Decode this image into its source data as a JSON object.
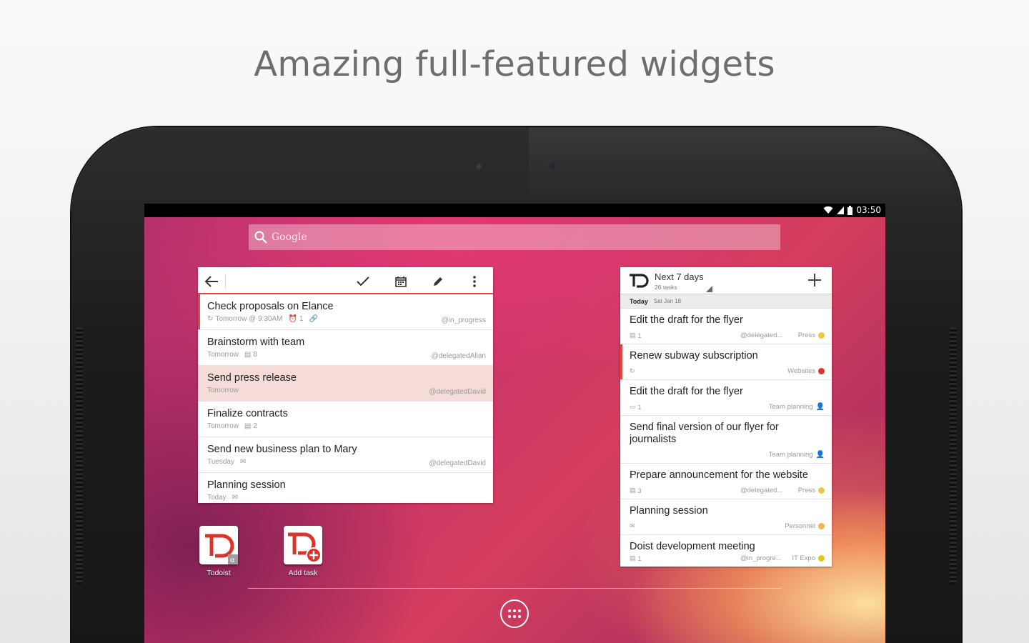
{
  "headline": "Amazing full-featured widgets",
  "status_bar": {
    "time": "03:50",
    "icons": [
      "wifi-icon",
      "signal-icon",
      "battery-icon"
    ]
  },
  "search": {
    "placeholder": "Google"
  },
  "task_widget": {
    "toolbar": {
      "back_icon": "arrow-back-icon",
      "actions": [
        "check-icon",
        "calendar-icon",
        "pencil-icon",
        "overflow-menu-icon"
      ]
    },
    "items": [
      {
        "title": "Check proposals on Elance",
        "date": "Tomorrow @ 9:30AM",
        "reminders": "1",
        "label": "@in_progress",
        "recurring": true,
        "link": true,
        "active": true
      },
      {
        "title": "Brainstorm with team",
        "date": "Tomorrow",
        "comments": "8",
        "label": "@delegatedAllan"
      },
      {
        "title": "Send press release",
        "date": "Tomorrow",
        "label": "@delegatedDavid",
        "selected": true
      },
      {
        "title": "Finalize contracts",
        "date": "Tomorrow",
        "comments": "2",
        "label": ""
      },
      {
        "title": "Send new business plan to Mary",
        "date": "Tuesday",
        "label": "@delegatedDavid",
        "email": true
      },
      {
        "title": "Planning session",
        "date": "Today",
        "email": true
      }
    ]
  },
  "next7_widget": {
    "title": "Next 7 days",
    "subtitle": "26 tasks",
    "section": {
      "label": "Today",
      "date": "Sat Jan 18"
    },
    "items": [
      {
        "title": "Edit the draft for the flyer",
        "meta": "1",
        "meta_icon": "comment-icon",
        "label": "@delegated...",
        "project": "Press",
        "color": "#f4c542"
      },
      {
        "title": "Renew subway subscription",
        "meta": "",
        "meta_icon": "recurring-icon",
        "label": "",
        "project": "Websites",
        "color": "#d9362b",
        "bar": true
      },
      {
        "title": "Edit the draft for the flyer",
        "meta": "1",
        "meta_icon": "comment-outline-icon",
        "label": "",
        "project": "Team planning",
        "color": "#f4b351",
        "person": true
      },
      {
        "title": "Send final version of our flyer for journalists",
        "meta": "",
        "meta_icon": "",
        "label": "",
        "project": "Team planning",
        "color": "#f4b351",
        "person": true,
        "tall": true
      },
      {
        "title": "Prepare announcement for the website",
        "meta": "3",
        "meta_icon": "comment-icon",
        "label": "@delegated...",
        "project": "Press",
        "color": "#f4c542"
      },
      {
        "title": "Planning session",
        "meta": "",
        "meta_icon": "email-icon",
        "label": "",
        "project": "Personnel",
        "color": "#f4b351"
      },
      {
        "title": "Doist development meeting",
        "meta": "1",
        "meta_icon": "comment-icon",
        "label": "@in_progre...",
        "project": "IT Expo",
        "color": "#e8c41a",
        "last": true
      }
    ]
  },
  "home_apps": [
    {
      "label": "Todoist",
      "icon": "todoist-icon"
    },
    {
      "label": "Add task",
      "icon": "todoist-add-task-icon"
    }
  ],
  "app_drawer": {
    "icon": "apps-grid-icon"
  }
}
